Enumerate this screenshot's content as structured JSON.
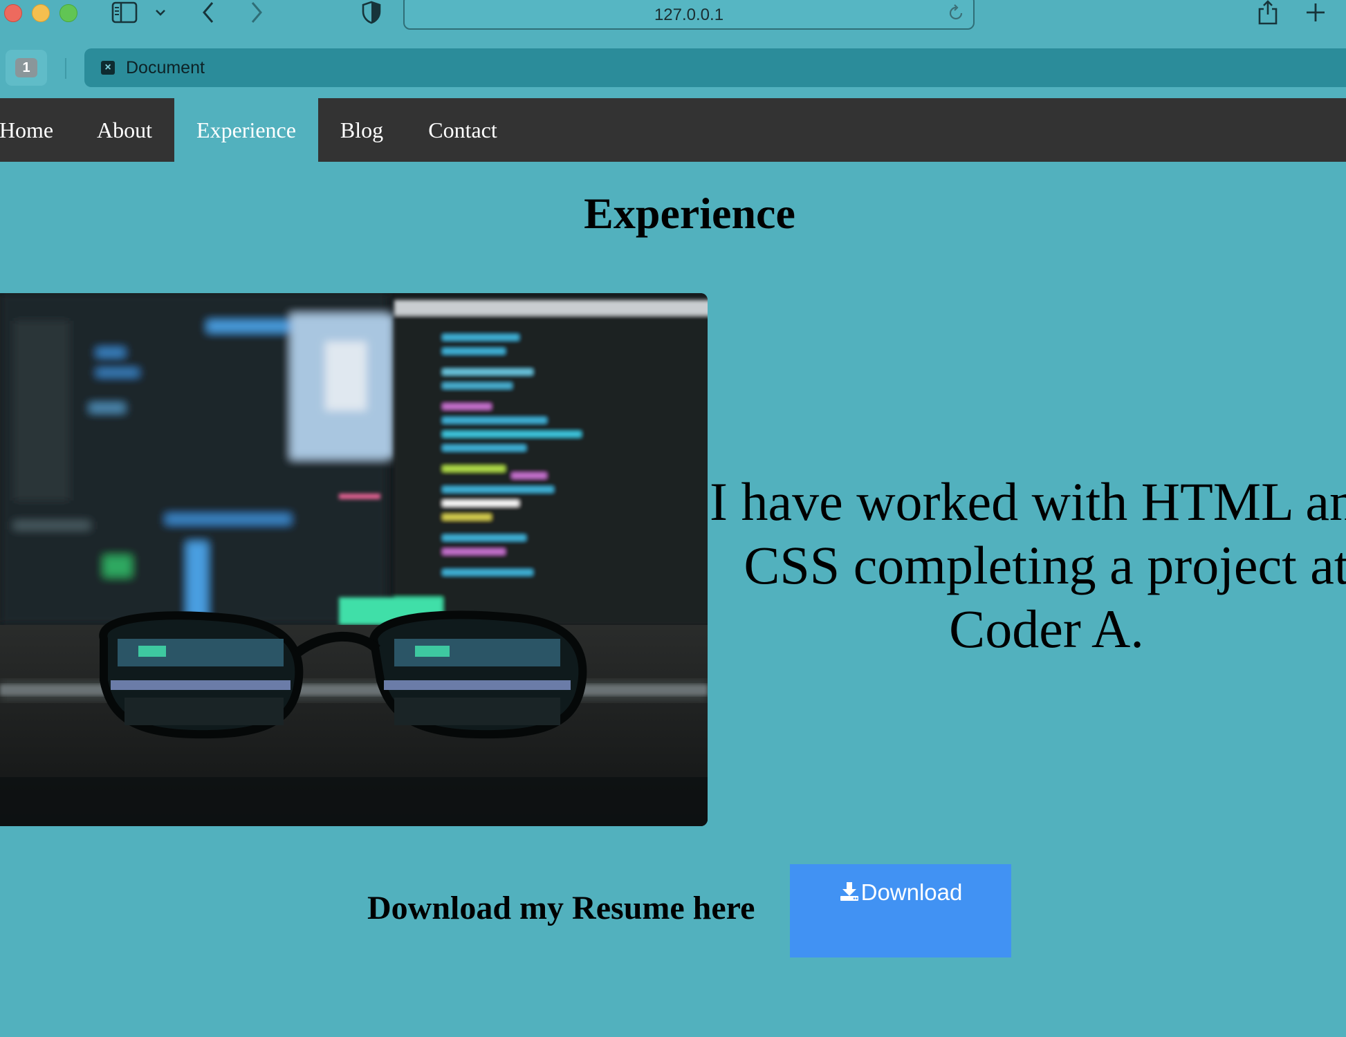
{
  "browser": {
    "url": "127.0.0.1",
    "tab_count": "1",
    "tab_title": "Document"
  },
  "nav": {
    "items": [
      {
        "label": "Home"
      },
      {
        "label": "About"
      },
      {
        "label": "Experience",
        "active": true
      },
      {
        "label": "Blog"
      },
      {
        "label": "Contact"
      }
    ]
  },
  "main": {
    "title": "Experience",
    "hero_text": "I have worked with HTML and CSS completing a project at Coder A.",
    "resume_label": "Download my Resume here",
    "download_label": "Download"
  },
  "colors": {
    "page_bg": "#52b1be",
    "nav_bg": "#333333",
    "button_bg": "#4192f3"
  }
}
